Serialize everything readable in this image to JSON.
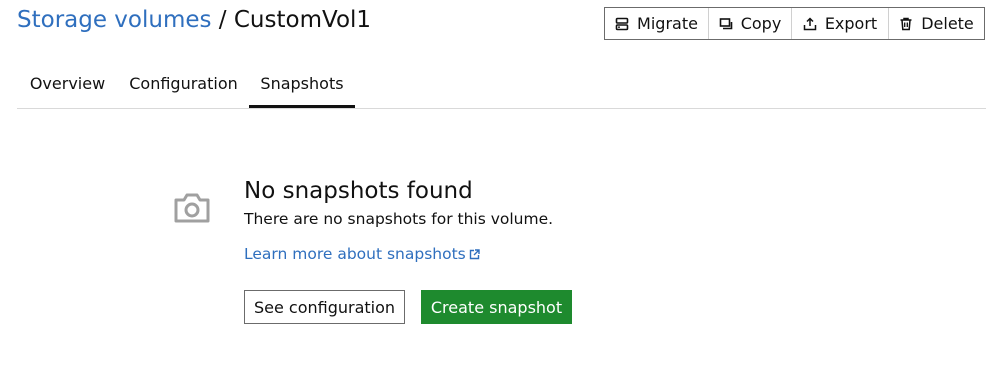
{
  "breadcrumb": {
    "parent": "Storage volumes",
    "separator": " / ",
    "current": "CustomVol1"
  },
  "actions": [
    {
      "label": "Migrate",
      "icon": "migrate-icon"
    },
    {
      "label": "Copy",
      "icon": "copy-icon"
    },
    {
      "label": "Export",
      "icon": "export-icon"
    },
    {
      "label": "Delete",
      "icon": "delete-icon"
    }
  ],
  "tabs": [
    {
      "label": "Overview",
      "active": false
    },
    {
      "label": "Configuration",
      "active": false
    },
    {
      "label": "Snapshots",
      "active": true
    }
  ],
  "empty_state": {
    "icon": "camera-icon",
    "title": "No snapshots found",
    "description": "There are no snapshots for this volume.",
    "link_text": "Learn more about snapshots",
    "secondary_button": "See configuration",
    "primary_button": "Create snapshot"
  },
  "colors": {
    "link": "#2f6fbe",
    "primary_button": "#1e8a2e",
    "icon_gray": "#a0a0a0"
  }
}
